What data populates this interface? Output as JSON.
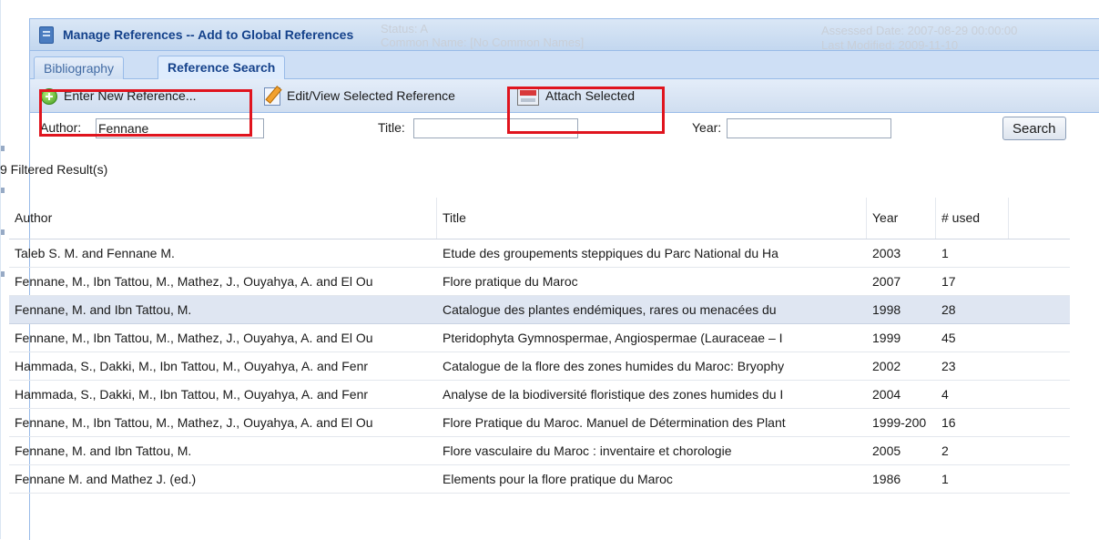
{
  "background": {
    "status": "Status: A",
    "common_name": "Common Name: [No Common Names]",
    "assessed_date": "Assessed Date: 2007-08-29 00:00:00",
    "last_modified": "Last Modified: 2009-11-10"
  },
  "dialog": {
    "title": "Manage References -- Add to Global References"
  },
  "tabs": [
    {
      "label": "Bibliography",
      "active": false
    },
    {
      "label": "Reference Search",
      "active": true
    }
  ],
  "toolbar": {
    "enter_new_label": "Enter New Reference...",
    "edit_view_label": "Edit/View Selected Reference",
    "attach_label": "Attach Selected"
  },
  "search": {
    "author_label": "Author:",
    "author_value": "Fennane",
    "title_label": "Title:",
    "title_value": "",
    "year_label": "Year:",
    "year_value": "",
    "button_label": "Search"
  },
  "result_count": "9 Filtered Result(s)",
  "grid": {
    "columns": [
      "Author",
      "Title",
      "Year",
      "# used"
    ],
    "rows": [
      {
        "author": "Taleb S. M. and Fennane M.",
        "title": "Etude des groupements steppiques du Parc National du Ha",
        "year": "2003",
        "used": "1",
        "selected": false
      },
      {
        "author": "Fennane, M., Ibn Tattou, M., Mathez, J., Ouyahya, A. and El Ou",
        "title": "Flore pratique du Maroc",
        "year": "2007",
        "used": "17",
        "selected": false
      },
      {
        "author": "Fennane, M. and Ibn Tattou, M.",
        "title": "Catalogue des plantes endémiques, rares ou menacées du",
        "year": "1998",
        "used": "28",
        "selected": true
      },
      {
        "author": "Fennane, M., Ibn Tattou, M., Mathez, J., Ouyahya, A. and El Ou",
        "title": "Pteridophyta Gymnospermae, Angiospermae (Lauraceae – I",
        "year": "1999",
        "used": "45",
        "selected": false
      },
      {
        "author": "Hammada, S., Dakki, M., Ibn Tattou, M., Ouyahya, A. and Fenr",
        "title": "Catalogue de la flore des zones humides du Maroc: Bryophy",
        "year": "2002",
        "used": "23",
        "selected": false
      },
      {
        "author": "Hammada, S., Dakki, M., Ibn Tattou, M., Ouyahya, A. and Fenr",
        "title": "Analyse de la biodiversité floristique des zones humides du I",
        "year": "2004",
        "used": "4",
        "selected": false
      },
      {
        "author": "Fennane, M., Ibn Tattou, M., Mathez, J., Ouyahya, A. and El Ou",
        "title": "Flore Pratique du Maroc. Manuel de Détermination des Plant",
        "year": "1999-200",
        "used": "16",
        "selected": false
      },
      {
        "author": "Fennane, M. and Ibn Tattou, M.",
        "title": "Flore vasculaire du Maroc : inventaire et chorologie",
        "year": "2005",
        "used": "2",
        "selected": false
      },
      {
        "author": "Fennane M. and Mathez J. (ed.)",
        "title": "Elements pour la flore pratique du Maroc",
        "year": "1986",
        "used": "1",
        "selected": false
      }
    ]
  },
  "colors": {
    "highlight": "#e0141e",
    "header_blue": "#15428b",
    "selected_row": "#dfe6f2"
  }
}
